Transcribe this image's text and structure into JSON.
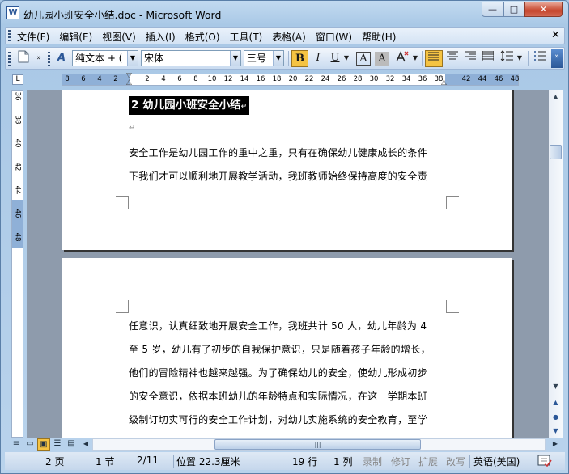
{
  "window": {
    "title": "幼儿园小班安全小结.doc - Microsoft Word",
    "app_icon": "W",
    "minimize": "—",
    "maximize": "□",
    "close": "✕"
  },
  "menu": {
    "items": [
      "文件(F)",
      "编辑(E)",
      "视图(V)",
      "插入(I)",
      "格式(O)",
      "工具(T)",
      "表格(A)",
      "窗口(W)",
      "帮助(H)"
    ],
    "doc_close": "✕"
  },
  "toolbar": {
    "style_value": "纯文本 + (",
    "font_value": "宋体",
    "size_value": "三号",
    "bold": "B",
    "italic": "I",
    "underline": "U",
    "char_border": "A",
    "char_shading": "A"
  },
  "ruler": {
    "corner": "L",
    "h_labels": [
      "8",
      "6",
      "4",
      "2",
      "2",
      "4",
      "6",
      "8",
      "10",
      "12",
      "14",
      "16",
      "18",
      "20",
      "22",
      "24",
      "26",
      "28",
      "30",
      "32",
      "34",
      "36",
      "38",
      "42",
      "44",
      "46",
      "48"
    ],
    "v_labels": [
      "36",
      "38",
      "40",
      "42",
      "44",
      "46",
      "48"
    ]
  },
  "document": {
    "heading": "2 幼儿园小班安全小结",
    "para_mark": "↵",
    "page1_lines": [
      "安全工作是幼儿园工作的重中之重，只有在确保幼儿健康成长的条件",
      "下我们才可以顺利地开展教学活动，我班教师始终保持高度的安全责"
    ],
    "page2_lines": [
      "任意识，认真细致地开展安全工作，我班共计 50 人，幼儿年龄为 4",
      "至 5 岁，幼儿有了初步的自我保护意识，只是随着孩子年龄的增长，",
      "他们的冒险精神也越来越强。为了确保幼儿的安全，使幼儿形成初步",
      "的安全意识，依据本班幼儿的年龄特点和实际情况，在这一学期本班",
      "级制订切实可行的安全工作计划，对幼儿实施系统的安全教育，至学"
    ]
  },
  "scroll": {
    "up": "▲",
    "down": "▼",
    "prev": "▲",
    "select": "●",
    "next": "▼",
    "left": "◀",
    "right": "▶",
    "grip": "|||"
  },
  "status": {
    "page": "2 页",
    "section": "1 节",
    "page_of": "2/11",
    "position": "位置 22.3厘米",
    "line": "19 行",
    "column": "1 列",
    "rec": "录制",
    "trk": "修订",
    "ext": "扩展",
    "ovr": "改写",
    "language": "英语(美国)"
  },
  "colors": {
    "accent": "#2b5797",
    "selection": "#000000",
    "bold_active": "#f5c342"
  }
}
